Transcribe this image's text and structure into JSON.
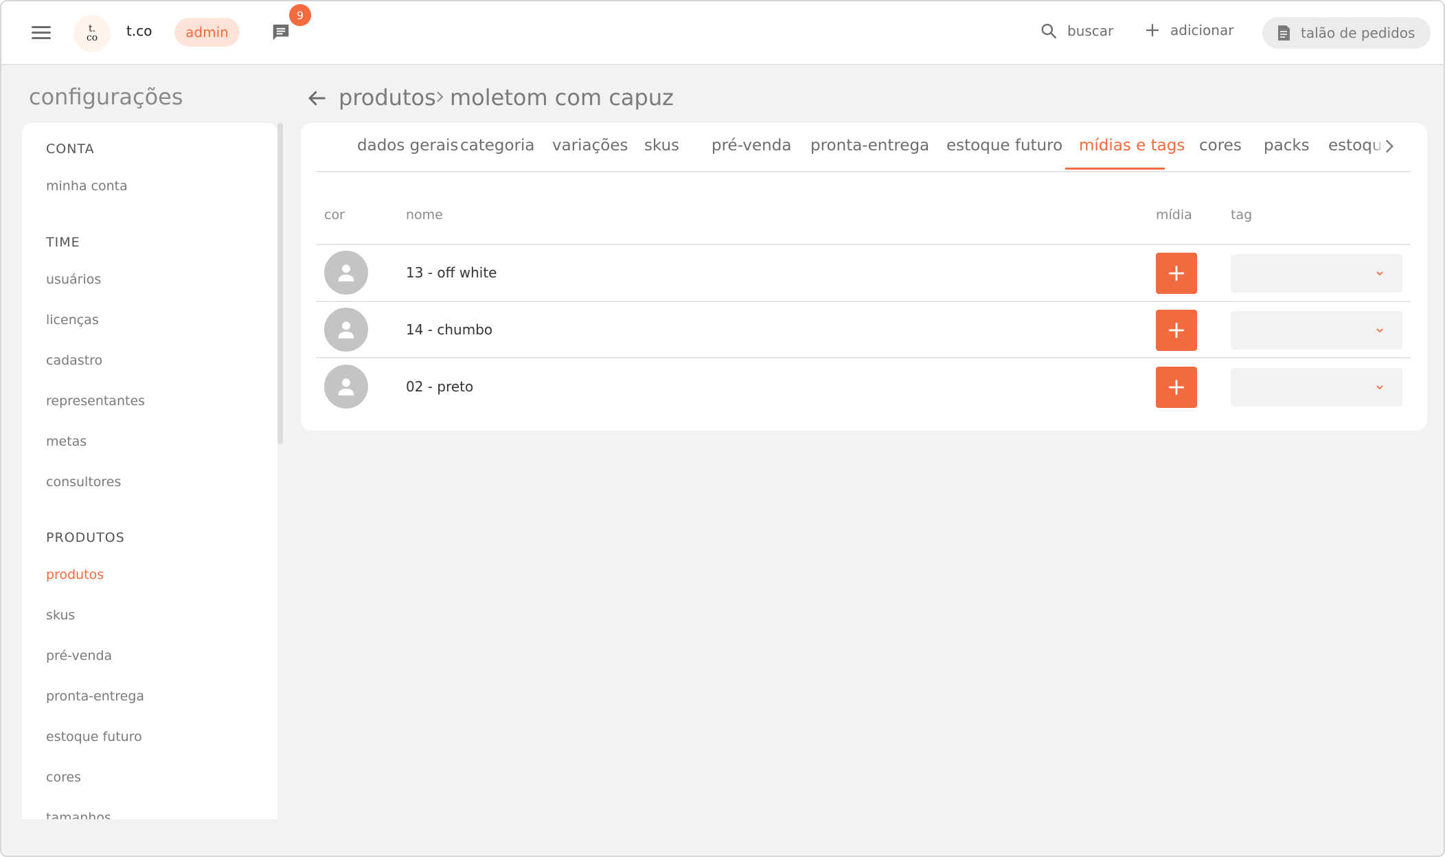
{
  "header": {
    "brand": "t.co",
    "logo_text_line1": "t.",
    "logo_text_line2": "co",
    "role": "admin",
    "notifications_count": "9",
    "search_label": "buscar",
    "add_label": "adicionar",
    "order_book_label": "talão de pedidos"
  },
  "sidebar": {
    "title": "configurações",
    "sections": [
      {
        "heading": "CONTA",
        "items": [
          "minha conta"
        ]
      },
      {
        "heading": "TIME",
        "items": [
          "usuários",
          "licenças",
          "cadastro",
          "representantes",
          "metas",
          "consultores"
        ]
      },
      {
        "heading": "PRODUTOS",
        "items": [
          "produtos",
          "skus",
          "pré-venda",
          "pronta-entrega",
          "estoque futuro",
          "cores",
          "tamanhos"
        ]
      }
    ],
    "active_item": "produtos"
  },
  "breadcrumb": {
    "parent": "produtos",
    "current": "moletom com capuz"
  },
  "tabs": [
    "dados gerais",
    "categoria",
    "variações",
    "skus",
    "pré-venda",
    "pronta-entrega",
    "estoque futuro",
    "mídias e tags",
    "cores",
    "packs",
    "estoque"
  ],
  "active_tab": "mídias e tags",
  "table": {
    "columns": {
      "color": "cor",
      "name": "nome",
      "media": "mídia",
      "tag": "tag"
    },
    "rows": [
      {
        "name": "13 - off white",
        "tag": ""
      },
      {
        "name": "14 - chumbo",
        "tag": ""
      },
      {
        "name": "02 - preto",
        "tag": ""
      }
    ]
  },
  "colors": {
    "accent": "#f26a3d",
    "accent_soft": "#fde3d8",
    "background": "#f2f2f2"
  },
  "icons": {
    "menu": "hamburger-icon",
    "chat": "chat-icon",
    "search": "search-icon",
    "add": "plus-icon",
    "order_book": "document-icon",
    "back": "arrow-left-icon",
    "tabs_next": "chevron-right-icon",
    "swatch_placeholder": "person-icon",
    "select": "chevron-down-icon"
  }
}
